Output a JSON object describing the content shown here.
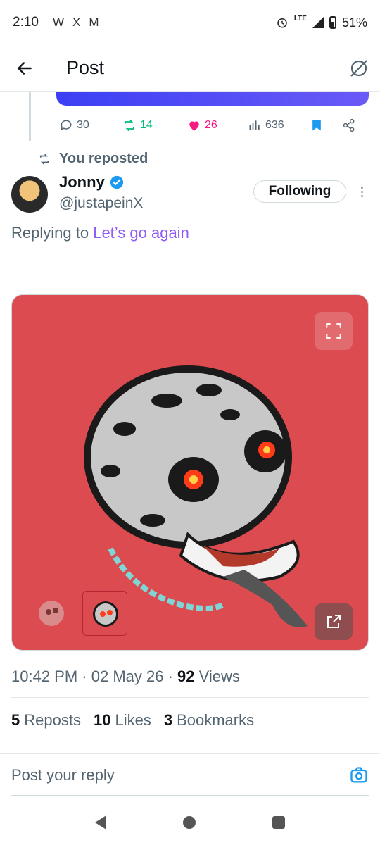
{
  "status_bar": {
    "time": "2:10",
    "battery": "51%",
    "network": "LTE",
    "app_icons": [
      "W",
      "X",
      "M"
    ]
  },
  "header": {
    "title": "Post"
  },
  "previous_post": {
    "replies": "30",
    "reposts": "14",
    "likes": "26",
    "views": "636"
  },
  "post": {
    "repost_label": "You reposted",
    "author_name": "Jonny",
    "author_handle": "@justapeinX",
    "follow_label": "Following",
    "replying_prefix": "Replying to",
    "replying_to": "Let’s go again",
    "time": "10:42 PM",
    "date": "02 May 26",
    "views_count": "92",
    "views_label": "Views",
    "reposts_count": "5",
    "reposts_label": "Reposts",
    "likes_count": "10",
    "likes_label": "Likes",
    "bookmarks_count": "3",
    "bookmarks_label": "Bookmarks"
  },
  "composer": {
    "placeholder": "Post your reply"
  },
  "colors": {
    "accent_blue": "#1d9bf0",
    "repost_green": "#00ba7c",
    "like_pink": "#f91880",
    "link_purple": "#8e5bf5",
    "media_bg": "#db4b4f"
  }
}
